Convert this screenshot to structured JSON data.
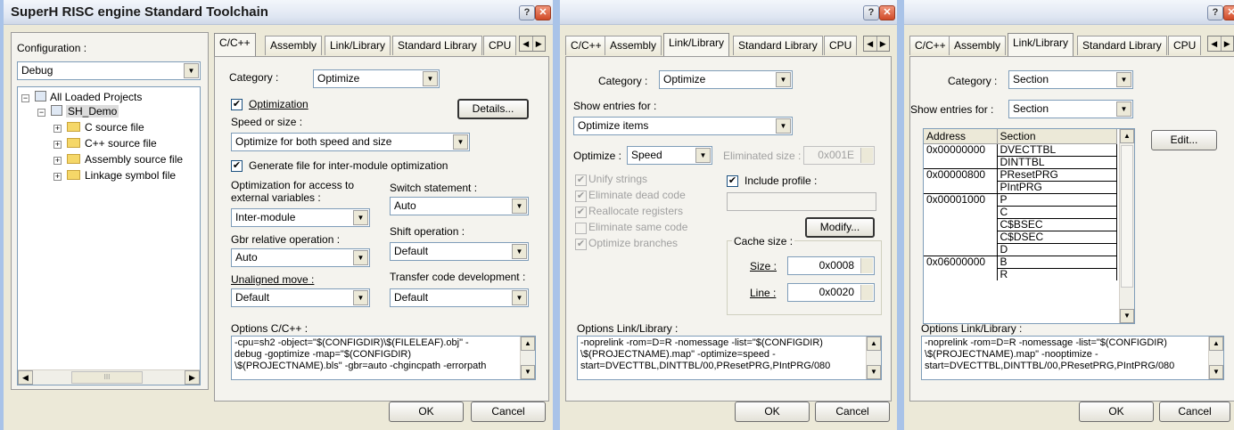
{
  "dialog1": {
    "title": "SuperH RISC engine Standard Toolchain",
    "help_label": "?",
    "close_label": "✕",
    "config_label": "Configuration :",
    "config_value": "Debug",
    "tree": {
      "root": "All Loaded Projects",
      "project": "SH_Demo",
      "items": [
        "C source file",
        "C++ source file",
        "Assembly source file",
        "Linkage symbol file"
      ]
    },
    "tabs": [
      "C/C++",
      "Assembly",
      "Link/Library",
      "Standard Library",
      "CPU"
    ],
    "category_label": "Category :",
    "category_value": "Optimize",
    "optimization_label": "Optimization",
    "details_button": "Details...",
    "speed_label": "Speed or size :",
    "speed_value": "Optimize for both speed and size",
    "generate_label": "Generate file for inter-module optimization",
    "access_label_1": "Optimization for access to",
    "access_label_2": "external variables :",
    "access_value": "Inter-module",
    "switch_label": "Switch statement :",
    "switch_value": "Auto",
    "gbr_label": "Gbr relative operation :",
    "gbr_value": "Auto",
    "shift_label": "Shift operation :",
    "shift_value": "Default",
    "unaligned_label": "Unaligned move :",
    "unaligned_value": "Default",
    "transfer_label": "Transfer code development :",
    "transfer_value": "Default",
    "options_label": "Options C/C++ :",
    "options_lines": [
      "-cpu=sh2 -object=\"$(CONFIGDIR)\\$(FILELEAF).obj\" -",
      "debug -goptimize -map=\"$(CONFIGDIR)",
      "\\$(PROJECTNAME).bls\" -gbr=auto -chgincpath -errorpath"
    ],
    "scroll_thumb": "III",
    "ok": "OK",
    "cancel": "Cancel"
  },
  "dialog2": {
    "help_label": "?",
    "close_label": "✕",
    "tabs": [
      "C/C++",
      "Assembly",
      "Link/Library",
      "Standard Library",
      "CPU"
    ],
    "category_label": "Category :",
    "category_value": "Optimize",
    "show_label": "Show entries for :",
    "show_value": "Optimize items",
    "optimize_label": "Optimize :",
    "optimize_value": "Speed",
    "eliminated_label": "Eliminated size :",
    "eliminated_value": "0x001E",
    "options": [
      {
        "label": "Unify strings",
        "checked": true
      },
      {
        "label": "Eliminate dead code",
        "checked": true
      },
      {
        "label": "Reallocate registers",
        "checked": true
      },
      {
        "label": "Eliminate same code",
        "checked": false
      },
      {
        "label": "Optimize branches",
        "checked": true
      }
    ],
    "include_profile_label": "Include profile :",
    "modify_button": "Modify...",
    "cache_label": "Cache size :",
    "size_label": "Size :",
    "size_value": "0x0008",
    "line_label": "Line :",
    "line_value": "0x0020",
    "options_label": "Options Link/Library :",
    "options_lines": [
      "-noprelink -rom=D=R -nomessage -list=\"$(CONFIGDIR)",
      "\\$(PROJECTNAME).map\" -optimize=speed -",
      "start=DVECTTBL,DINTTBL/00,PResetPRG,PIntPRG/080"
    ],
    "ok": "OK",
    "cancel": "Cancel"
  },
  "dialog3": {
    "help_label": "?",
    "close_label": "✕",
    "tabs": [
      "C/C++",
      "Assembly",
      "Link/Library",
      "Standard Library",
      "CPU"
    ],
    "category_label": "Category :",
    "category_value": "Section",
    "show_label": "Show entries for :",
    "show_value": "Section",
    "edit_button": "Edit...",
    "columns": [
      "Address",
      "Section"
    ],
    "rows": [
      {
        "address": "0x00000000",
        "section": "DVECTTBL"
      },
      {
        "address": "",
        "section": "DINTTBL"
      },
      {
        "address": "0x00000800",
        "section": "PResetPRG"
      },
      {
        "address": "",
        "section": "PIntPRG"
      },
      {
        "address": "0x00001000",
        "section": "P"
      },
      {
        "address": "",
        "section": "C"
      },
      {
        "address": "",
        "section": "C$BSEC"
      },
      {
        "address": "",
        "section": "C$DSEC"
      },
      {
        "address": "",
        "section": "D"
      },
      {
        "address": "0x06000000",
        "section": "B"
      },
      {
        "address": "",
        "section": "R"
      }
    ],
    "options_label": "Options Link/Library :",
    "options_lines": [
      "-noprelink -rom=D=R -nomessage -list=\"$(CONFIGDIR)",
      "\\$(PROJECTNAME).map\" -nooptimize -",
      "start=DVECTTBL,DINTTBL/00,PResetPRG,PIntPRG/080"
    ],
    "ok": "OK",
    "cancel": "Cancel"
  },
  "colors": {
    "desktop": "#a9c3e8",
    "dialog": "#ece9d8",
    "titlebar": "#dfe6f2",
    "close_button": "#d04b28"
  }
}
